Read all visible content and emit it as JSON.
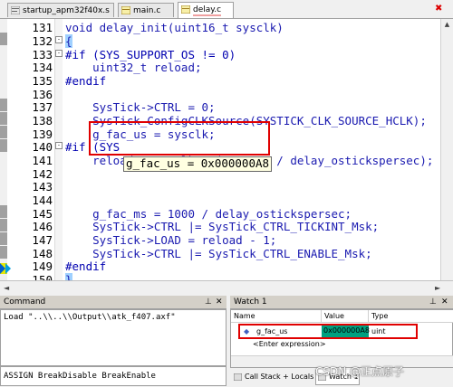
{
  "tabs": [
    {
      "label": "startup_apm32f40x.s",
      "icon": "asm-file-icon",
      "active": false
    },
    {
      "label": "main.c",
      "icon": "c-file-icon",
      "active": false
    },
    {
      "label": "delay.c",
      "icon": "c-file-icon",
      "active": true
    }
  ],
  "editor": {
    "lines": [
      {
        "no": "131",
        "text": "void delay_init(uint16_t sysclk)"
      },
      {
        "no": "132",
        "text": "{"
      },
      {
        "no": "133",
        "text": "#if (SYS_SUPPORT_OS != 0)"
      },
      {
        "no": "134",
        "text": "    uint32_t reload;"
      },
      {
        "no": "135",
        "text": "#endif"
      },
      {
        "no": "136",
        "text": ""
      },
      {
        "no": "137",
        "text": "    SysTick->CTRL = 0;"
      },
      {
        "no": "138",
        "text": "    SysTick_ConfigCLKSource(SYSTICK_CLK_SOURCE_HCLK);"
      },
      {
        "no": "139",
        "text": "    g_fac_us = sysclk;"
      },
      {
        "no": "140",
        "text": "#if (SYS"
      },
      {
        "no": "141",
        "text": "    reload = sysclk * (1000000 / delay_ostickspersec);"
      },
      {
        "no": "142",
        "text": ""
      },
      {
        "no": "143",
        "text": ""
      },
      {
        "no": "144",
        "text": ""
      },
      {
        "no": "145",
        "text": "    g_fac_ms = 1000 / delay_ostickspersec;"
      },
      {
        "no": "146",
        "text": "    SysTick->CTRL |= SysTick_CTRL_TICKINT_Msk;"
      },
      {
        "no": "147",
        "text": "    SysTick->LOAD = reload - 1;"
      },
      {
        "no": "148",
        "text": "    SysTick->CTRL |= SysTick_CTRL_ENABLE_Msk;"
      },
      {
        "no": "149",
        "text": "#endif"
      },
      {
        "no": "150",
        "text": "}"
      }
    ],
    "tooltip": "g_fac_us = 0x000000A8"
  },
  "command": {
    "title": "Command",
    "output": "Load \"..\\\\..\\\\Output\\\\atk_f407.axf\"",
    "input_hint": "ASSIGN BreakDisable BreakEnable"
  },
  "watch": {
    "title": "Watch 1",
    "columns": [
      "Name",
      "Value",
      "Type"
    ],
    "rows": [
      {
        "name": "g_fac_us",
        "value": "0x000000A8",
        "type": "uint"
      },
      {
        "name": "<Enter expression>",
        "value": "",
        "type": ""
      }
    ],
    "bottom_tabs": [
      "Call Stack + Locals",
      "Watch 1"
    ]
  },
  "watermark": "CSDN @正点原子",
  "colors": {
    "highlight_value": "#00a080",
    "annotation_red": "#e00000",
    "code_blue": "#1a1ab0",
    "number_red": "#c00000"
  }
}
